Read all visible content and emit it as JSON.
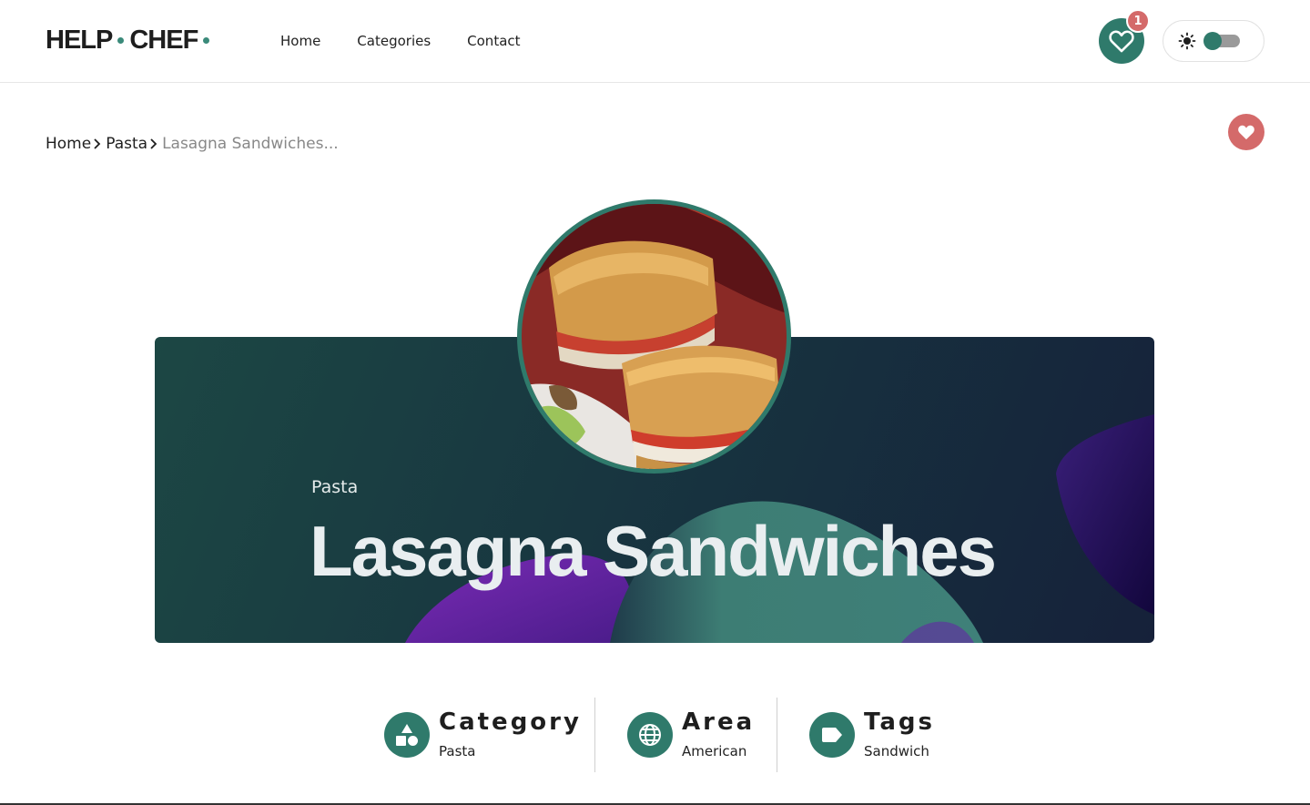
{
  "header": {
    "logo_part1": "HELP",
    "logo_part2": "CHEF",
    "nav": [
      "Home",
      "Categories",
      "Contact"
    ],
    "favorites_count": "1"
  },
  "breadcrumb": {
    "items": [
      "Home",
      "Pasta"
    ],
    "current": "Lasagna Sandwiches..."
  },
  "hero": {
    "category": "Pasta",
    "title": "Lasagna Sandwiches"
  },
  "info": [
    {
      "title": "Category",
      "value": "Pasta",
      "icon": "shapes-icon"
    },
    {
      "title": "Area",
      "value": "American",
      "icon": "globe-icon"
    },
    {
      "title": "Tags",
      "value": "Sandwich",
      "icon": "tag-icon"
    }
  ],
  "colors": {
    "accent": "#2f7a6b",
    "badge": "#d46a6a",
    "hero_bg": "#17323f"
  }
}
